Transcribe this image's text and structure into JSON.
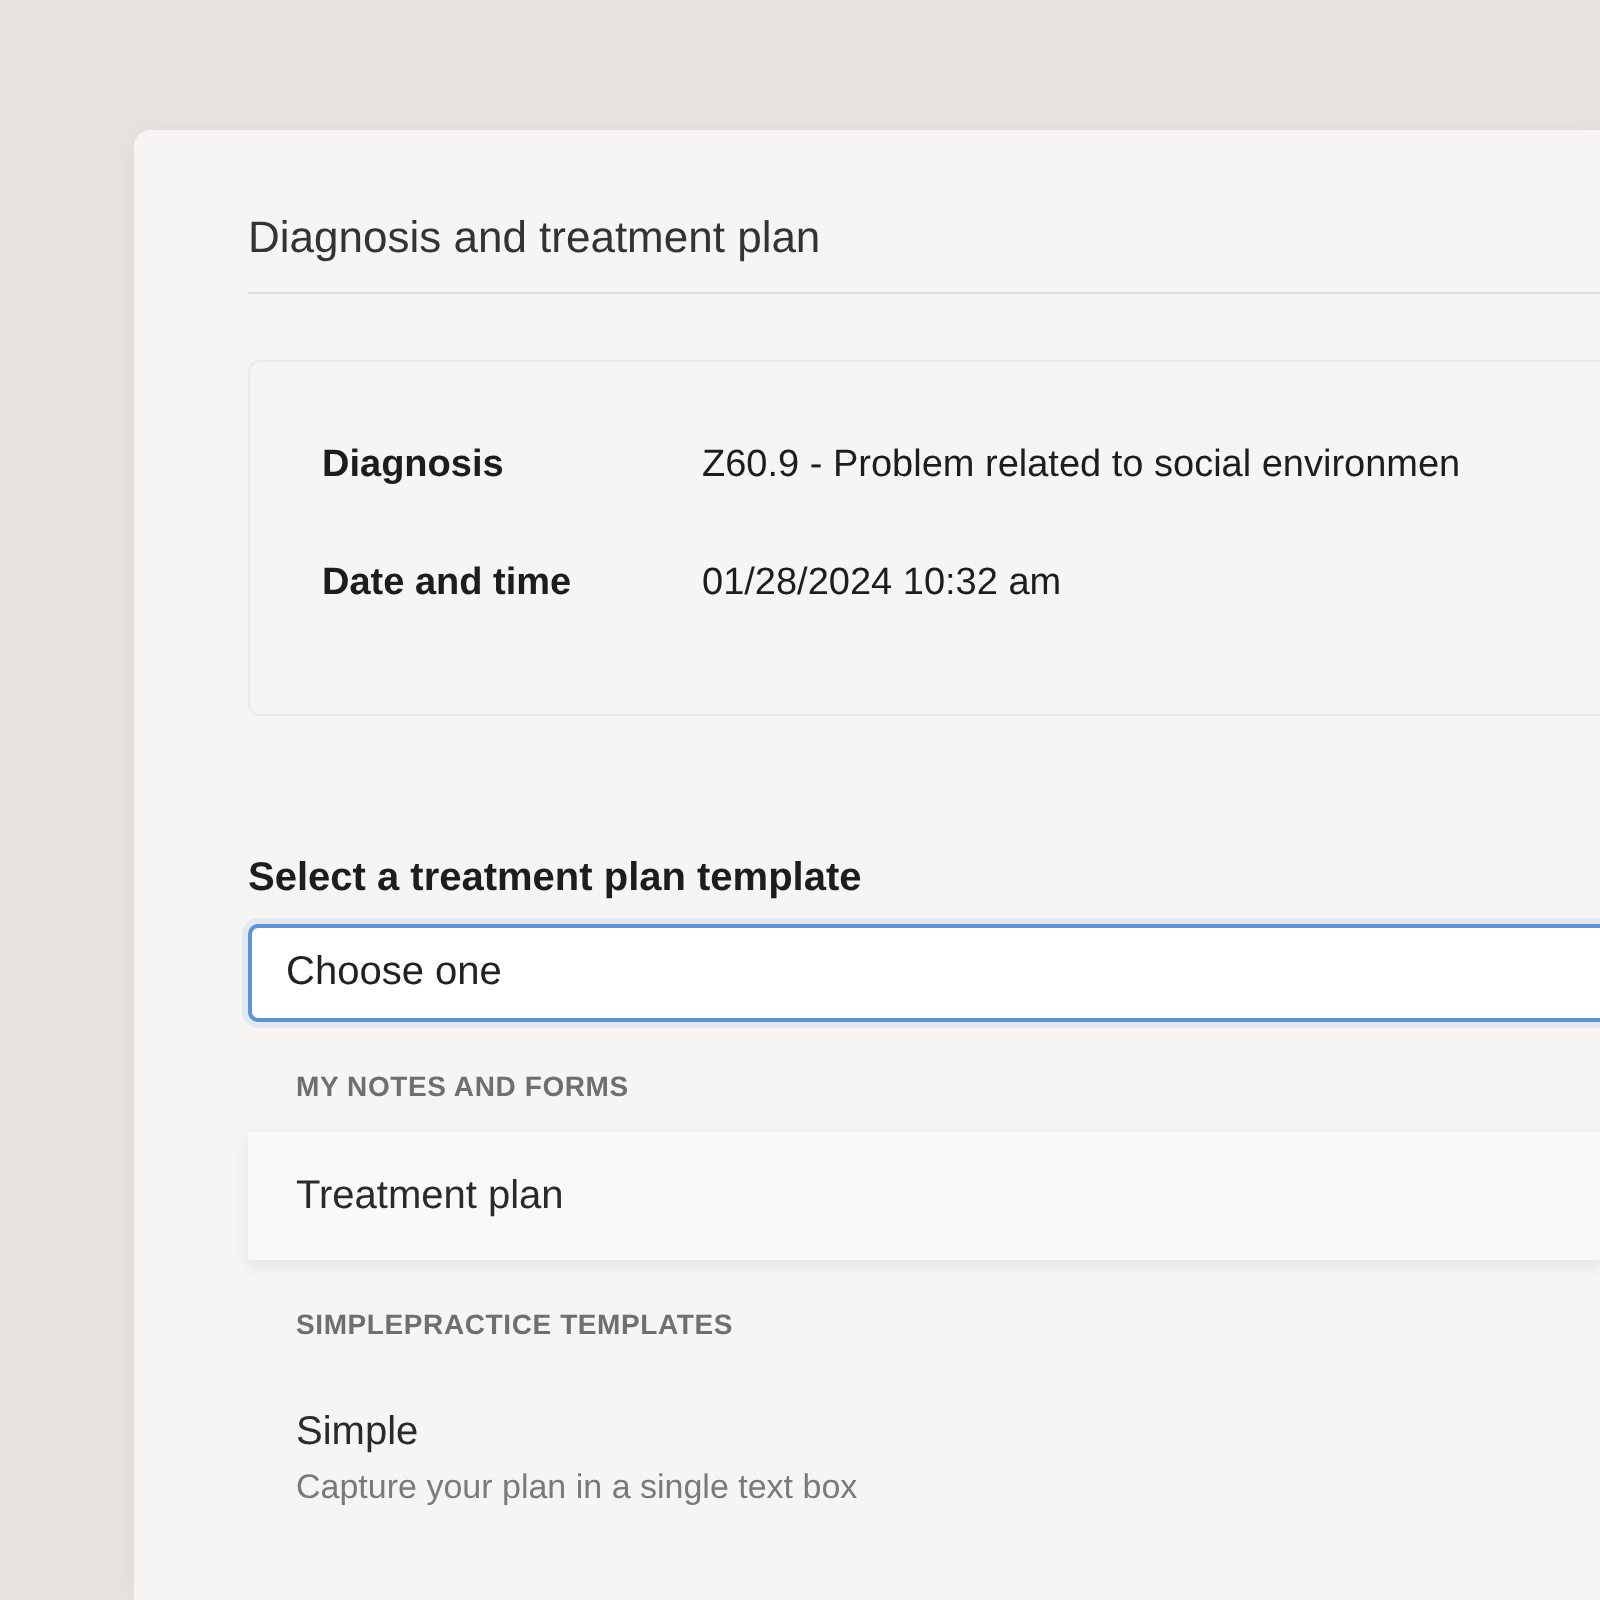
{
  "title": "Diagnosis and treatment plan",
  "details": [
    {
      "label": "Diagnosis",
      "value": "Z60.9 - Problem related to social environmen"
    },
    {
      "label": "Date and time",
      "value": "01/28/2024 10:32 am"
    }
  ],
  "template_select": {
    "label": "Select a treatment plan template",
    "value": "Choose one",
    "focused": true
  },
  "option_groups": [
    {
      "heading": "MY NOTES AND FORMS",
      "options": [
        {
          "name": "Treatment plan",
          "selected": true
        }
      ]
    },
    {
      "heading": "SIMPLEPRACTICE TEMPLATES",
      "options": [
        {
          "name": "Simple",
          "description": "Capture your plan in a single text box",
          "selected": false
        }
      ]
    }
  ]
}
